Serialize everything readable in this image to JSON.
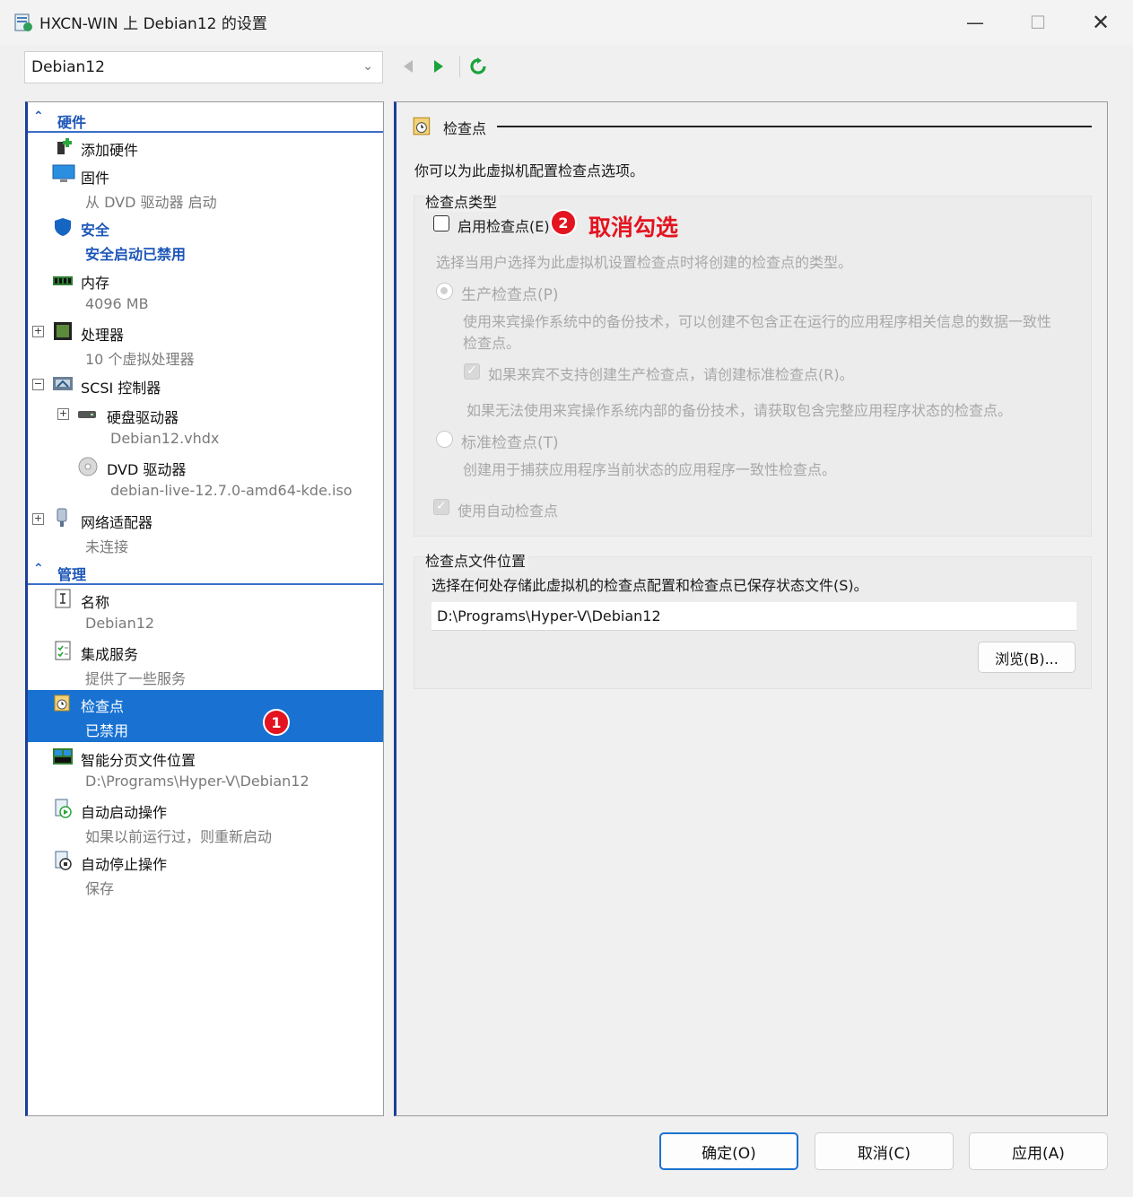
{
  "window": {
    "title": "HXCN-WIN 上 Debian12 的设置",
    "minimize": "—",
    "maximize": "☐",
    "close": "✕"
  },
  "vm_select": {
    "value": "Debian12"
  },
  "tree": {
    "hardware_header": "硬件",
    "hardware": [
      {
        "name": "添加硬件",
        "sub": ""
      },
      {
        "name": "固件",
        "sub": "从 DVD 驱动器 启动"
      },
      {
        "name": "安全",
        "sub": "安全启动已禁用"
      },
      {
        "name": "内存",
        "sub": "4096 MB"
      },
      {
        "name": "处理器",
        "sub": "10 个虚拟处理器"
      },
      {
        "name": "SCSI 控制器",
        "sub": ""
      },
      {
        "name": "硬盘驱动器",
        "sub": "Debian12.vhdx"
      },
      {
        "name": "DVD 驱动器",
        "sub": "debian-live-12.7.0-amd64-kde.iso"
      },
      {
        "name": "网络适配器",
        "sub": "未连接"
      }
    ],
    "management_header": "管理",
    "management": [
      {
        "name": "名称",
        "sub": "Debian12"
      },
      {
        "name": "集成服务",
        "sub": "提供了一些服务"
      },
      {
        "name": "检查点",
        "sub": "已禁用"
      },
      {
        "name": "智能分页文件位置",
        "sub": "D:\\Programs\\Hyper-V\\Debian12"
      },
      {
        "name": "自动启动操作",
        "sub": "如果以前运行过，则重新启动"
      },
      {
        "name": "自动停止操作",
        "sub": "保存"
      }
    ]
  },
  "annotations": {
    "badge1": "1",
    "badge2": "2",
    "note": "取消勾选"
  },
  "panel": {
    "title": "检查点",
    "description": "你可以为此虚拟机配置检查点选项。",
    "type_group": {
      "label": "检查点类型",
      "enable_checkbox": {
        "label": "启用检查点(E)",
        "checked": false
      },
      "hint": "选择当用户选择为此虚拟机设置检查点时将创建的检查点的类型。",
      "production": {
        "label": "生产检查点(P)",
        "selected": true,
        "desc_line1": "使用来宾操作系统中的备份技术，可以创建不包含正在运行的应用程序相关信息的数据一致性",
        "desc_line2": "检查点。",
        "fallback_checkbox": {
          "label": "如果来宾不支持创建生产检查点，请创建标准检查点(R)。",
          "checked": true
        },
        "fallback_desc": "如果无法使用来宾操作系统内部的备份技术，请获取包含完整应用程序状态的检查点。"
      },
      "standard": {
        "label": "标准检查点(T)",
        "selected": false,
        "desc": "创建用于捕获应用程序当前状态的应用程序一致性检查点。"
      },
      "auto_checkbox": {
        "label": "使用自动检查点",
        "checked": true
      }
    },
    "location_group": {
      "label": "检查点文件位置",
      "desc": "选择在何处存储此虚拟机的检查点配置和检查点已保存状态文件(S)。",
      "path": "D:\\Programs\\Hyper-V\\Debian12",
      "browse_label": "浏览(B)..."
    }
  },
  "footer": {
    "ok": "确定(O)",
    "cancel": "取消(C)",
    "apply": "应用(A)"
  },
  "colors": {
    "accent": "#1972d2",
    "annotation": "#e3141f",
    "section_header": "#1d56b8"
  }
}
